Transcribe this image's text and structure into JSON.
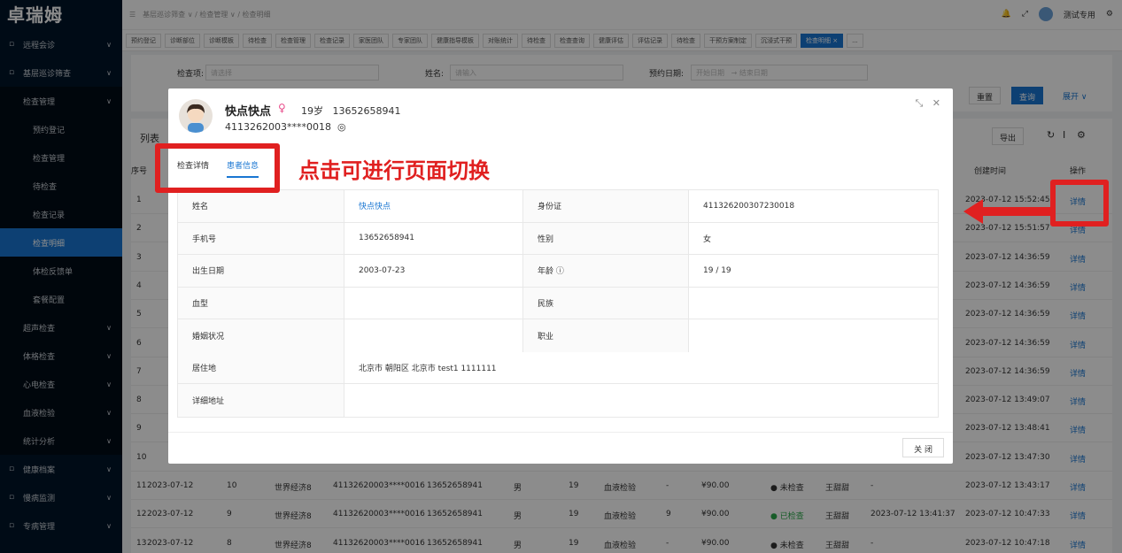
{
  "app": {
    "logo": "卓瑞姆"
  },
  "header": {
    "breadcrumb": [
      "基层巡诊筛查 ∨",
      "/ 检查管理 ∨",
      "/ 检查明细"
    ],
    "user": "测试专用"
  },
  "sidebar": {
    "items": [
      {
        "label": "远程会诊",
        "level": 0
      },
      {
        "label": "基层巡诊筛查",
        "level": 0
      },
      {
        "label": "检查管理",
        "level": 1
      },
      {
        "label": "预约登记",
        "level": 2
      },
      {
        "label": "检查管理",
        "level": 2
      },
      {
        "label": "待检查",
        "level": 2
      },
      {
        "label": "检查记录",
        "level": 2
      },
      {
        "label": "检查明细",
        "level": 2,
        "active": true
      },
      {
        "label": "体检反馈单",
        "level": 2
      },
      {
        "label": "套餐配置",
        "level": 2
      },
      {
        "label": "超声检查",
        "level": 1
      },
      {
        "label": "体格检查",
        "level": 1
      },
      {
        "label": "心电检查",
        "level": 1
      },
      {
        "label": "血液检验",
        "level": 1
      },
      {
        "label": "统计分析",
        "level": 1
      },
      {
        "label": "健康档案",
        "level": 0
      },
      {
        "label": "慢病监测",
        "level": 0
      },
      {
        "label": "专病管理",
        "level": 0
      }
    ]
  },
  "tabs": [
    "预约登记",
    "诊断部位",
    "诊断模板",
    "待检查",
    "检查管理",
    "检查记录",
    "家医团队",
    "专家团队",
    "健康指导模板",
    "对账统计",
    "待检查",
    "检查查询",
    "健康评估",
    "评估记录",
    "待检查",
    "干预方案制定",
    "沉浸式干预",
    "检查明细 ×",
    "..."
  ],
  "filter": {
    "item_label": "检查项:",
    "item_placeholder": "请选择",
    "name_label": "姓名:",
    "name_placeholder": "请输入",
    "date_label": "预约日期:",
    "date_start": "开始日期",
    "date_sep": "→",
    "date_end": "结束日期",
    "reset": "重置",
    "search": "查询",
    "expand": "展开 ∨"
  },
  "list": {
    "title": "列表",
    "export": "导出",
    "col_no": "序号",
    "col_created": "创建时间",
    "col_op": "操作",
    "detail": "详情",
    "rows": [
      {
        "no": "1",
        "created": "2023-07-12 15:52:45"
      },
      {
        "no": "2",
        "created": "2023-07-12 15:51:57"
      },
      {
        "no": "3",
        "created": "2023-07-12 14:36:59"
      },
      {
        "no": "4",
        "created": "2023-07-12 14:36:59"
      },
      {
        "no": "5",
        "created": "2023-07-12 14:36:59"
      },
      {
        "no": "6",
        "created": "2023-07-12 14:36:59"
      },
      {
        "no": "7",
        "created": "2023-07-12 14:36:59"
      },
      {
        "no": "8",
        "created": "2023-07-12 13:49:07"
      },
      {
        "no": "9",
        "created": "2023-07-12 13:48:41"
      },
      {
        "no": "10",
        "created": "2023-07-12 13:47:30"
      },
      {
        "no": "11",
        "date": "2023-07-12",
        "n": "10",
        "org": "世界经济8",
        "idno": "41132620003****0016",
        "phone": "13652658941",
        "sex": "男",
        "age": "19",
        "type": "血液检验",
        "x": "-",
        "price": "¥90.00",
        "status": "● 未检查",
        "doctor": "王甜甜",
        "time2": "-",
        "created": "2023-07-12 13:43:17"
      },
      {
        "no": "12",
        "date": "2023-07-12",
        "n": "9",
        "org": "世界经济8",
        "idno": "41132620003****0016",
        "phone": "13652658941",
        "sex": "男",
        "age": "19",
        "type": "血液检验",
        "x": "9",
        "price": "¥90.00",
        "status": "● 已检查",
        "doctor": "王甜甜",
        "time2": "2023-07-12 13:41:37",
        "created": "2023-07-12 10:47:33"
      },
      {
        "no": "13",
        "date": "2023-07-12",
        "n": "8",
        "org": "世界经济8",
        "idno": "41132620003****0016",
        "phone": "13652658941",
        "sex": "男",
        "age": "19",
        "type": "血液检验",
        "x": "-",
        "price": "¥90.00",
        "status": "● 未检查",
        "doctor": "王甜甜",
        "time2": "-",
        "created": "2023-07-12 10:47:18"
      }
    ]
  },
  "modal": {
    "name": "快点快点",
    "age": "19岁",
    "phone": "13652658941",
    "id_masked": "4113262003****0018",
    "tabs": [
      "检查详情",
      "患者信息"
    ],
    "annotation": "点击可进行页面切换",
    "fields": [
      {
        "k": "姓名",
        "v": "快点快点",
        "k2": "身份证",
        "v2": "411326200307230018"
      },
      {
        "k": "手机号",
        "v": "13652658941",
        "k2": "性别",
        "v2": "女"
      },
      {
        "k": "出生日期",
        "v": "2003-07-23",
        "k2": "年龄 ⓘ",
        "v2": "19 / 19"
      },
      {
        "k": "血型",
        "v": "",
        "k2": "民族",
        "v2": ""
      },
      {
        "k": "婚姻状况",
        "v": "",
        "k2": "职业",
        "v2": ""
      }
    ],
    "address_label": "居住地",
    "address": "北京市 朝阳区 北京市 test1 1111111",
    "detail_addr_label": "详细地址",
    "detail_addr": "",
    "close": "关 闭"
  },
  "colors": {
    "primary": "#1976d2",
    "sidebar": "#001529",
    "annotation": "#e02020"
  }
}
